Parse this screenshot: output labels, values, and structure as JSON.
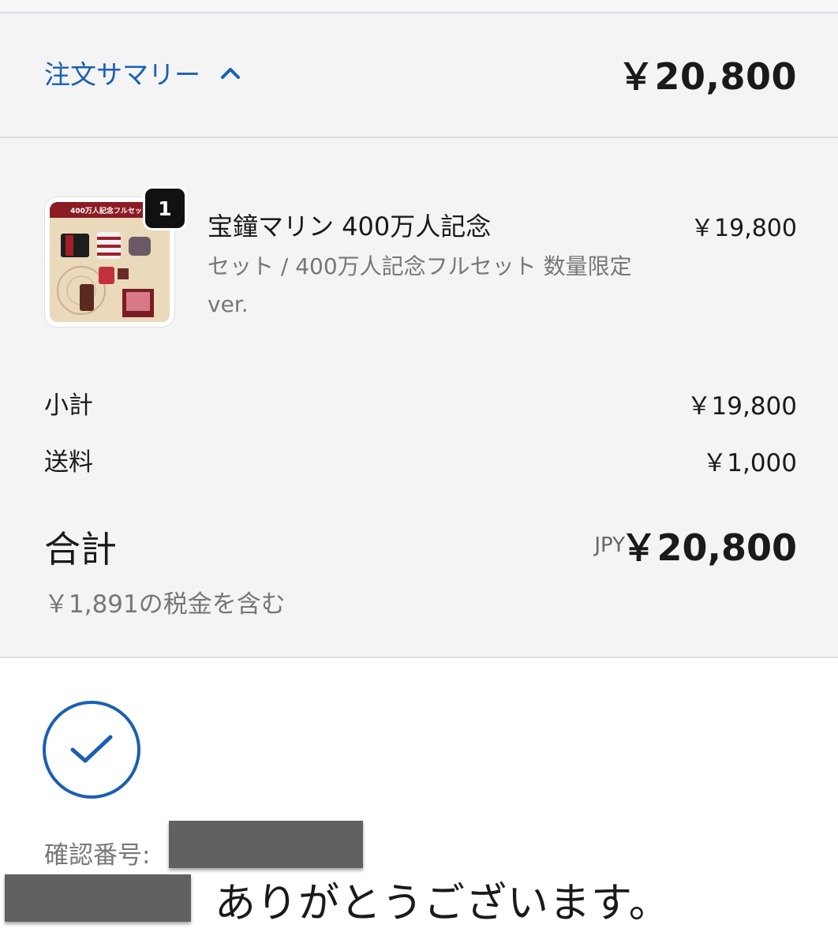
{
  "summary": {
    "toggle_label": "注文サマリー",
    "header_total": "￥20,800"
  },
  "product": {
    "name": "宝鐘マリン 400万人記念",
    "variant": "セット / 400万人記念フルセット 数量限定ver.",
    "price": "￥19,800",
    "quantity": "1",
    "image_caption": "400万人記念フルセット"
  },
  "costs": {
    "subtotal_label": "小計",
    "subtotal_value": "￥19,800",
    "shipping_label": "送料",
    "shipping_value": "￥1,000",
    "total_label": "合計",
    "currency": "JPY",
    "total_value": "￥20,800",
    "tax_note": "￥1,891の税金を含む"
  },
  "confirmation": {
    "number_label": "確認番号:",
    "thanks": "ありがとうございます。"
  },
  "colors": {
    "accent": "#1a5fb4",
    "panel": "#f4f4f4",
    "redaction": "#616161"
  }
}
